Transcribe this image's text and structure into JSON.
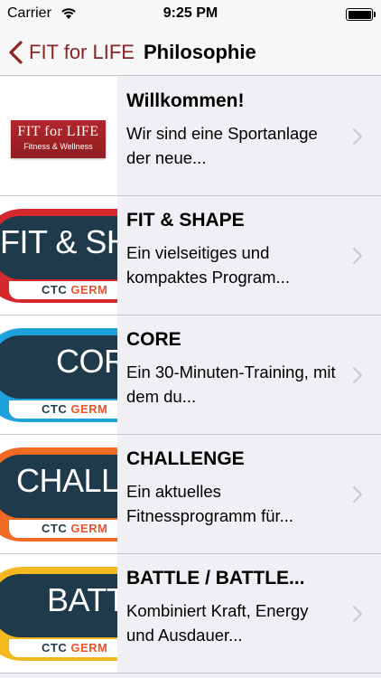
{
  "status_bar": {
    "carrier": "Carrier",
    "time": "9:25 PM",
    "wifi_icon": "wifi-icon",
    "battery_level": 1.0
  },
  "nav": {
    "back_label": "FIT for LIFE",
    "title": "Philosophie",
    "accent_color": "#8b2323"
  },
  "items": [
    {
      "title": "Willkommen!",
      "description": "Wir sind eine Sportanlage der neue...",
      "logo_line1": "FIT for LIFE",
      "logo_line2": "Fitness & Wellness"
    },
    {
      "title": "FIT & SHAPE",
      "description": "Ein vielseitiges und kompaktes Program...",
      "badge_word": "FIT & SH",
      "badge_foot_a": "CTC ",
      "badge_foot_b": "GERM",
      "badge_color": "#d42a2e"
    },
    {
      "title": "CORE",
      "description": "Ein 30-Minuten-Training, mit dem du...",
      "badge_word": "COR",
      "badge_foot_a": "CTC ",
      "badge_foot_b": "GERM",
      "badge_color": "#1ea2dc"
    },
    {
      "title": "CHALLENGE",
      "description": "Ein aktuelles Fitnessprogramm für...",
      "badge_word": "CHALLE",
      "badge_foot_a": "CTC ",
      "badge_foot_b": "GERM",
      "badge_color": "#ef6a22"
    },
    {
      "title": "BATTLE / BATTLE...",
      "description": "Kombiniert Kraft, Energy und Ausdauer...",
      "badge_word": "BATT",
      "badge_foot_a": "CTC ",
      "badge_foot_b": "GERM",
      "badge_color": "#f2b81d"
    }
  ]
}
